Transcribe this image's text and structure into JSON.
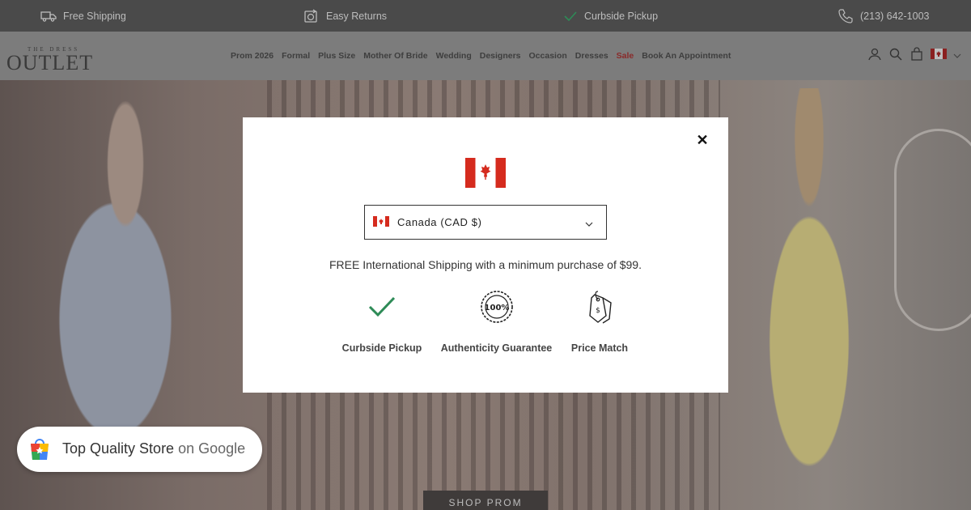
{
  "topbar": {
    "items": [
      {
        "label": "Free Shipping",
        "icon": "truck-icon"
      },
      {
        "label": "Easy Returns",
        "icon": "returns-icon"
      },
      {
        "label": "Curbside Pickup",
        "icon": "check-icon"
      },
      {
        "label": "(213) 642-1003",
        "icon": "phone-icon"
      }
    ]
  },
  "header": {
    "logo_small": "THE DRESS",
    "logo_big": "OUTLET",
    "nav": [
      {
        "label": "Prom 2026"
      },
      {
        "label": "Formal"
      },
      {
        "label": "Plus Size"
      },
      {
        "label": "Mother Of Bride"
      },
      {
        "label": "Wedding"
      },
      {
        "label": "Designers"
      },
      {
        "label": "Occasion"
      },
      {
        "label": "Dresses"
      },
      {
        "label": "Sale"
      },
      {
        "label": "Book An Appointment"
      }
    ],
    "sale_color": "#8a2a2a"
  },
  "hero": {
    "cta": "SHOP PROM"
  },
  "modal": {
    "close": "✕",
    "country_select": "Canada (CAD $)",
    "shipping_text": "FREE International Shipping with a minimum purchase of $99.",
    "features": [
      {
        "label": "Curbside Pickup",
        "icon": "checkmark-icon"
      },
      {
        "label": "Authenticity Guarantee",
        "icon": "100-percent-badge-icon"
      },
      {
        "label": "Price Match",
        "icon": "price-tag-icon"
      }
    ],
    "accent_green": "#2e8b57",
    "flag_red": "#d52b1e"
  },
  "google_badge": {
    "text_main": "Top Quality Store",
    "text_on": "on Google"
  }
}
